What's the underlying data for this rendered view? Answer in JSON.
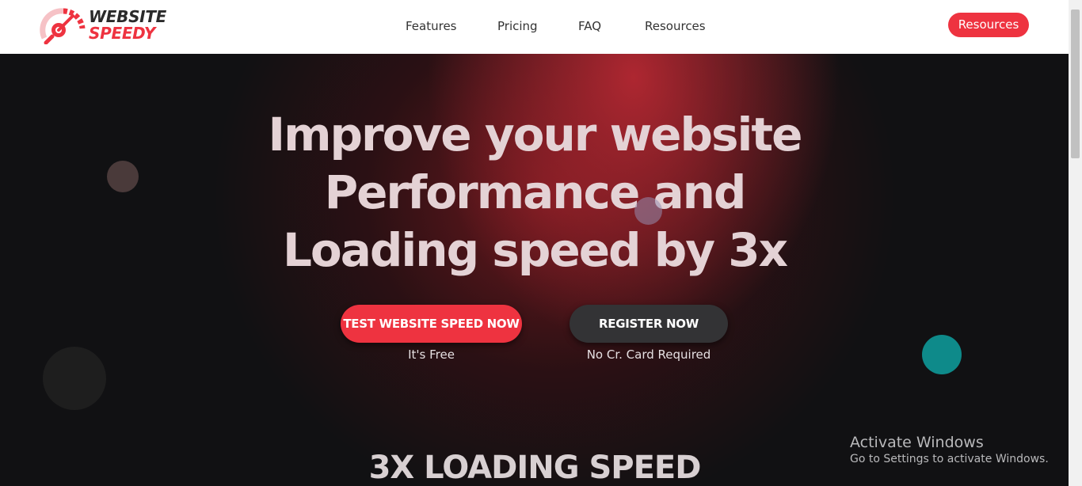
{
  "brand": {
    "line1": "WEBSITE",
    "line2": "SPEEDY",
    "accent": "#ee3340"
  },
  "nav": {
    "items": [
      "Features",
      "Pricing",
      "FAQ",
      "Resources"
    ],
    "button_label": "Resources"
  },
  "hero": {
    "headline": "Improve your website Performance and Loading speed by 3x",
    "primary_cta": "TEST WEBSITE SPEED NOW",
    "primary_sub": "It's Free",
    "secondary_cta": "REGISTER NOW",
    "secondary_sub": "No Cr. Card Required"
  },
  "section": {
    "title": "3X LOADING SPEED"
  },
  "overlay": {
    "title": "Activate Windows",
    "subtitle": "Go to Settings to activate Windows."
  }
}
